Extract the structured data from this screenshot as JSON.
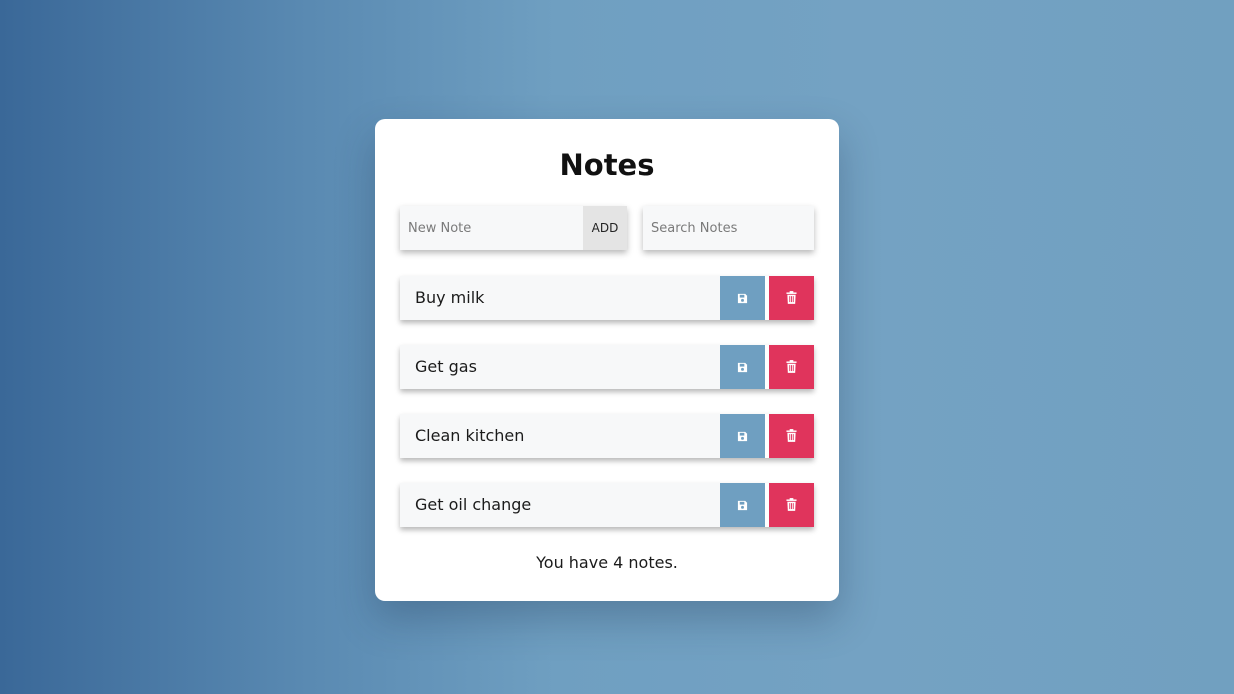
{
  "title": "Notes",
  "new_note": {
    "placeholder": "New Note",
    "value": "",
    "add_label": "ADD"
  },
  "search": {
    "placeholder": "Search Notes",
    "value": ""
  },
  "notes": [
    {
      "text": "Buy milk"
    },
    {
      "text": "Get gas"
    },
    {
      "text": "Clean kitchen"
    },
    {
      "text": "Get oil change"
    }
  ],
  "note_actions": {
    "save_icon": "floppy-disk-icon",
    "delete_icon": "trash-icon"
  },
  "count_text": "You have 4 notes.",
  "colors": {
    "save_accent": "#6f9fc1",
    "delete_accent": "#e0345c",
    "background_left": "#3a6898",
    "background_right": "#74a2c3"
  }
}
